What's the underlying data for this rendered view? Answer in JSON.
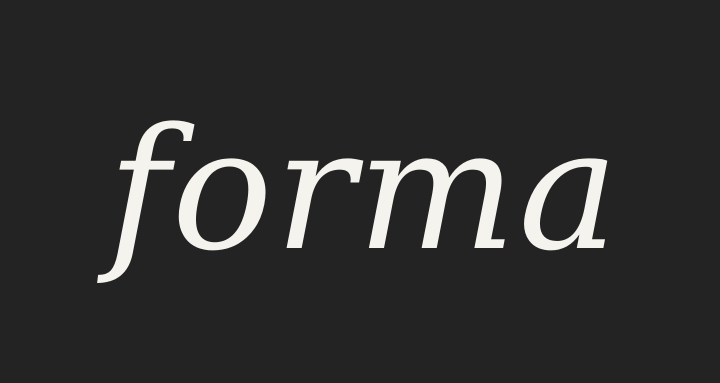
{
  "logo": {
    "wordmark": "forma",
    "text_color": "#f4f3ee",
    "background_color": "#232323"
  }
}
